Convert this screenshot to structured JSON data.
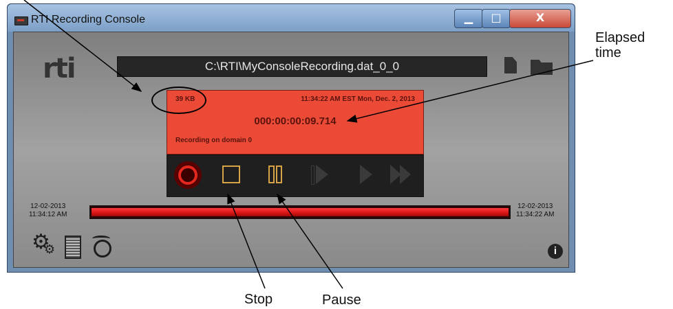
{
  "window": {
    "title": "RTI Recording Console",
    "controls": {
      "minimize": "▁",
      "maximize": "□",
      "close": "X"
    }
  },
  "logo": "rti",
  "file_path": "C:\\RTI\\MyConsoleRecording.dat_0_0",
  "status": {
    "size": "39 KB",
    "datetime": "11:34:22 AM EST  Mon, Dec. 2, 2013",
    "elapsed": "000:00:00:09.714",
    "recording_status": "Recording on domain 0"
  },
  "transport": {
    "buttons": [
      "record",
      "stop",
      "pause",
      "step-forward",
      "play",
      "fast-forward"
    ],
    "colors": {
      "record": "#e4281f",
      "active": "#d6a347",
      "disabled": "#3a3a3a"
    }
  },
  "timeline": {
    "start_date": "12-02-2013",
    "start_time": "11:34:12 AM",
    "end_date": "12-02-2013",
    "end_time": "11:34:22 AM",
    "progress": 1.0
  },
  "bottom_icons": [
    "gear-icon",
    "notepad-icon",
    "alarm-clock-icon",
    "info-icon"
  ],
  "annotations": {
    "elapsed_line1": "Elapsed",
    "elapsed_line2": "time",
    "stop": "Stop",
    "pause": "Pause"
  }
}
